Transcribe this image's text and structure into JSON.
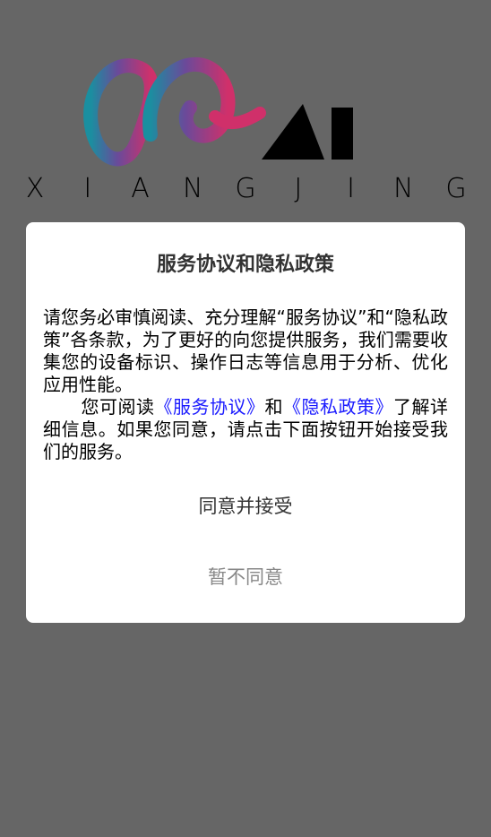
{
  "logo": {
    "wordmark_letters": [
      "X",
      "I",
      "A",
      "N",
      "G",
      "J",
      "I",
      "N",
      "G"
    ],
    "mark_text": "AI",
    "colors": {
      "swirl_start": "#1a8fa0",
      "swirl_end": "#d0306a",
      "mark": "#000000"
    }
  },
  "dialog": {
    "title": "服务协议和隐私政策",
    "paragraph1": "请您务必审慎阅读、充分理解“服务协议”和“隐私政策”各条款，为了更好的向您提供服务，我们需要收集您的设备标识、操作日志等信息用于分析、优化应用性能。",
    "p2_before": "您可阅读",
    "service_link": "《服务协议》",
    "p2_and": "和",
    "privacy_link": "《隐私政策》",
    "p2_after": "了解详细信息。如果您同意，请点击下面按钮开始接受我们的服务。",
    "agree_button": "同意并接受",
    "decline_button": "暂不同意"
  },
  "colors": {
    "backdrop": "#666666",
    "link": "#1a1aff",
    "decline_text": "#888888"
  }
}
